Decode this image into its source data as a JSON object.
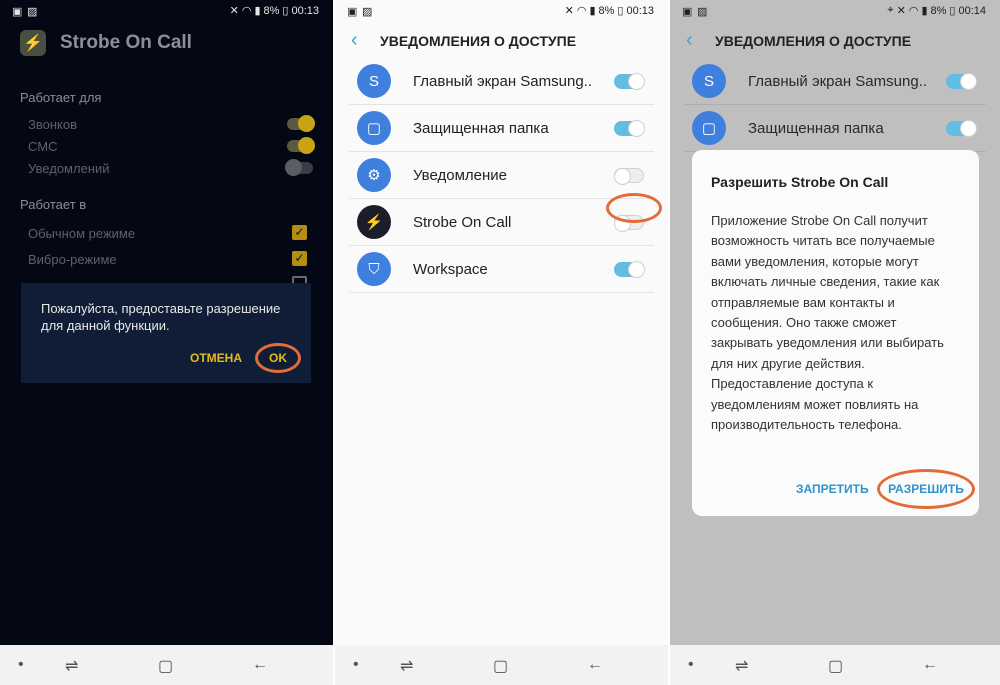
{
  "status": {
    "battery": "8%",
    "time1": "00:13",
    "time2": "00:13",
    "time3": "00:14"
  },
  "panel1": {
    "app_title": "Strobe On Call",
    "section_works_for": "Работает для",
    "rows_for": [
      "Звонков",
      "СМС",
      "Уведомлений"
    ],
    "section_works_in": "Работает в",
    "rows_in": [
      "Обычном режиме",
      "Вибро-режиме"
    ],
    "dialog": {
      "message": "Пожалуйста, предоставьте разрешение для данной функции.",
      "cancel": "ОТМЕНА",
      "ok": "OK"
    }
  },
  "panel2": {
    "title": "УВЕДОМЛЕНИЯ О ДОСТУПЕ",
    "items": [
      {
        "label": "Главный экран Samsung..",
        "on": true
      },
      {
        "label": "Защищенная папка",
        "on": true
      },
      {
        "label": "Уведомление",
        "on": false
      },
      {
        "label": "Strobe On Call",
        "on": false
      },
      {
        "label": "Workspace",
        "on": true
      }
    ]
  },
  "panel3": {
    "title": "УВЕДОМЛЕНИЯ О ДОСТУПЕ",
    "items": [
      {
        "label": "Главный экран Samsung..",
        "on": true
      },
      {
        "label": "Защищенная папка",
        "on": true
      }
    ],
    "dialog": {
      "title": "Разрешить Strobe On Call",
      "body": "Приложение Strobe On Call получит возможность читать все получаемые вами уведомления, которые могут включать личные сведения, такие как отправляемые вам контакты и сообщения. Оно также сможет закрывать уведомления или выбирать для них другие действия. Предоставление доступа к уведомлениям может повлиять на производительность телефона.",
      "deny": "ЗАПРЕТИТЬ",
      "allow": "РАЗРЕШИТЬ"
    }
  },
  "colors": {
    "accent_blue": "#3aa0d5",
    "highlight_circle": "#e36b3a",
    "dialog_yellow": "#e4bd1c"
  }
}
